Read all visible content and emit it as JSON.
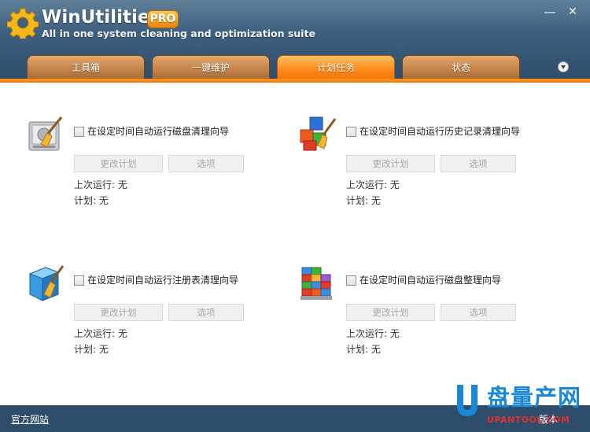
{
  "header": {
    "app_name": "WinUtilities",
    "badge": "PRO",
    "tagline": "All in one system cleaning and optimization suite",
    "minimize_glyph": "—",
    "close_glyph": "✕",
    "logo_icon": "gear-icon"
  },
  "tabs": [
    {
      "label": "工具箱",
      "active": false
    },
    {
      "label": "一键维护",
      "active": false
    },
    {
      "label": "计划任务",
      "active": true
    },
    {
      "label": "状态",
      "active": false
    }
  ],
  "tasks": [
    {
      "label": "在设定时间自动运行磁盘清理向导",
      "checked": false,
      "change_btn": "更改计划",
      "options_btn": "选项",
      "last_run": "上次运行: 无",
      "schedule": "计划: 无",
      "icon": "disk-cleaner-icon"
    },
    {
      "label": "在设定时间自动运行历史记录清理向导",
      "checked": false,
      "change_btn": "更改计划",
      "options_btn": "选项",
      "last_run": "上次运行: 无",
      "schedule": "计划: 无",
      "icon": "history-cleaner-icon"
    },
    {
      "label": "在设定时间自动运行注册表清理向导",
      "checked": false,
      "change_btn": "更改计划",
      "options_btn": "选项",
      "last_run": "上次运行: 无",
      "schedule": "计划: 无",
      "icon": "registry-cleaner-icon"
    },
    {
      "label": "在设定时间自动运行磁盘整理向导",
      "checked": false,
      "change_btn": "更改计划",
      "options_btn": "选项",
      "last_run": "上次运行: 无",
      "schedule": "计划: 无",
      "icon": "disk-defrag-icon"
    }
  ],
  "footer": {
    "link": "官方网站",
    "version": "版本"
  },
  "watermark": {
    "name": "盘量产网",
    "url": "UPANTOOL.COM"
  },
  "colors": {
    "accent": "#f07406",
    "header_bg": "#3f6180",
    "tab_inactive": "#c4844a",
    "watermark_blue": "#1a88d8",
    "watermark_red": "#e33030"
  }
}
